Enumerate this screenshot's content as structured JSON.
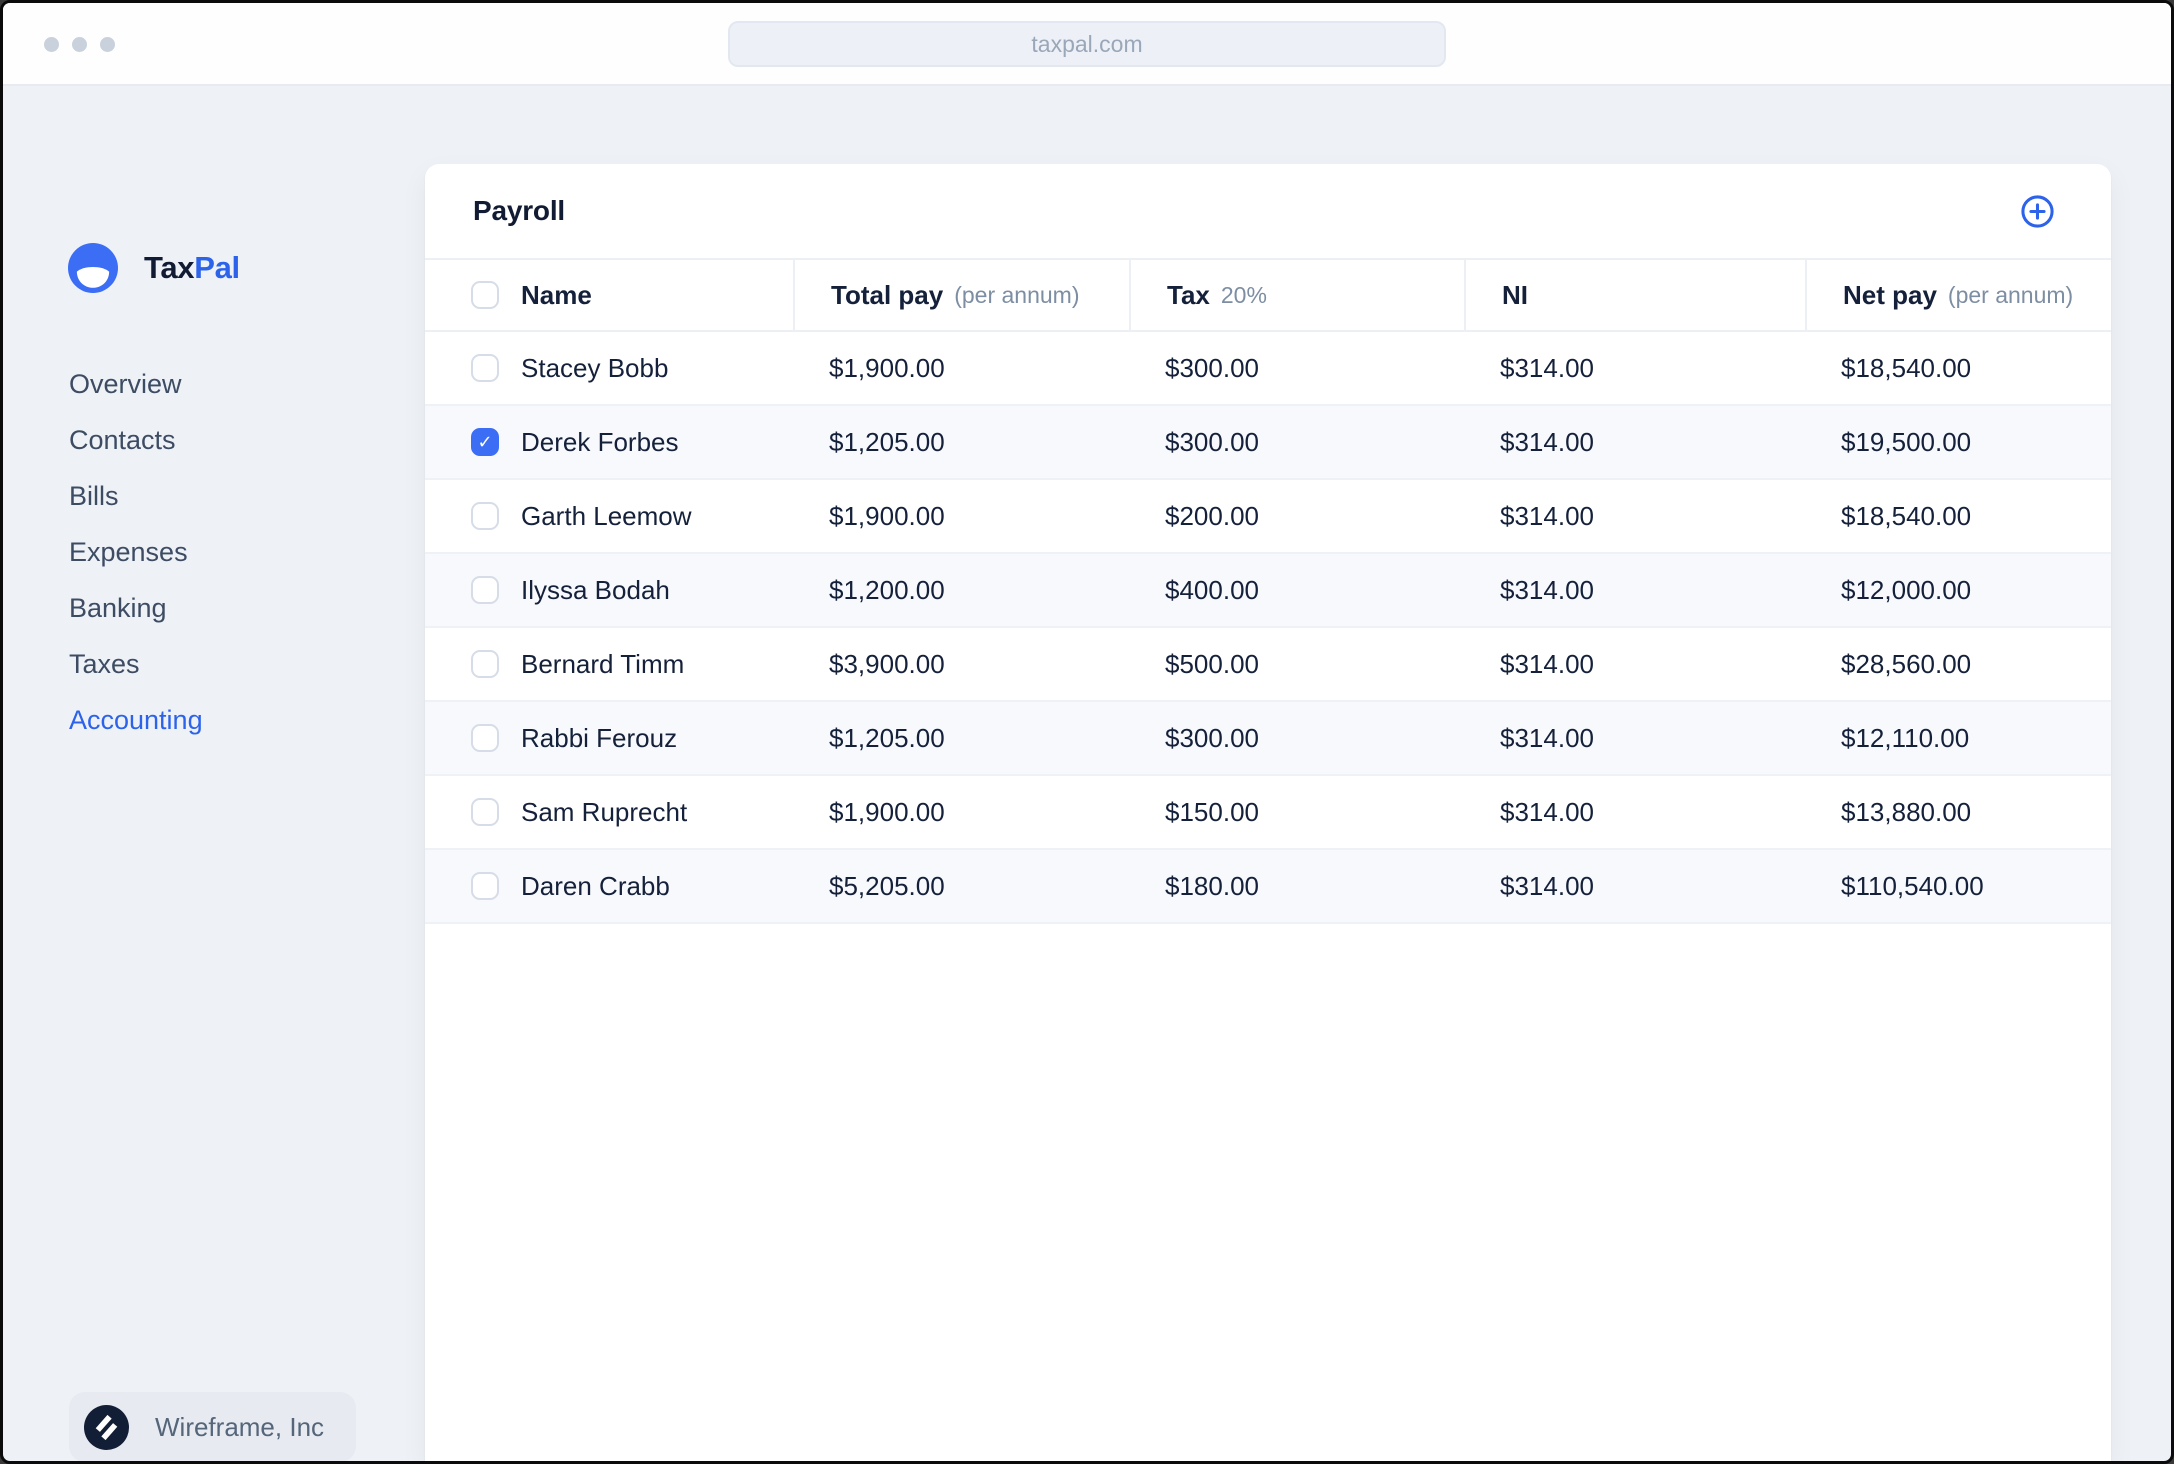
{
  "window": {
    "url": "taxpal.com"
  },
  "colors": {
    "accent": "#2d63ea",
    "checkbox_checked": "#3b6ef5",
    "text_dark": "#15213a",
    "text_muted": "#7d8ea3",
    "background": "#eef2f7"
  },
  "icons": {
    "window_controls": "window-dots-icon",
    "brand": "taxpal-logo-icon",
    "add": "plus-circle-icon",
    "company": "wireframe-logo-icon"
  },
  "sidebar": {
    "brand_primary": "Tax",
    "brand_secondary": "Pal",
    "items": [
      {
        "label": "Overview",
        "active": false
      },
      {
        "label": "Contacts",
        "active": false
      },
      {
        "label": "Bills",
        "active": false
      },
      {
        "label": "Expenses",
        "active": false
      },
      {
        "label": "Banking",
        "active": false
      },
      {
        "label": "Taxes",
        "active": false
      },
      {
        "label": "Accounting",
        "active": true
      }
    ],
    "company": "Wireframe, Inc"
  },
  "payroll": {
    "title": "Payroll",
    "columns": [
      {
        "label": "Name",
        "sublabel": ""
      },
      {
        "label": "Total pay",
        "sublabel": "(per annum)"
      },
      {
        "label": "Tax",
        "sublabel": "20%"
      },
      {
        "label": "NI",
        "sublabel": ""
      },
      {
        "label": "Net pay",
        "sublabel": "(per annum)"
      }
    ],
    "rows": [
      {
        "name": "Stacey Bobb",
        "total_pay": "$1,900.00",
        "tax": "$300.00",
        "ni": "$314.00",
        "net_pay": "$18,540.00",
        "checked": false
      },
      {
        "name": "Derek Forbes",
        "total_pay": "$1,205.00",
        "tax": "$300.00",
        "ni": "$314.00",
        "net_pay": "$19,500.00",
        "checked": true
      },
      {
        "name": "Garth Leemow",
        "total_pay": "$1,900.00",
        "tax": "$200.00",
        "ni": "$314.00",
        "net_pay": "$18,540.00",
        "checked": false
      },
      {
        "name": "Ilyssa Bodah",
        "total_pay": "$1,200.00",
        "tax": "$400.00",
        "ni": "$314.00",
        "net_pay": "$12,000.00",
        "checked": false
      },
      {
        "name": "Bernard Timm",
        "total_pay": "$3,900.00",
        "tax": "$500.00",
        "ni": "$314.00",
        "net_pay": "$28,560.00",
        "checked": false
      },
      {
        "name": "Rabbi Ferouz",
        "total_pay": "$1,205.00",
        "tax": "$300.00",
        "ni": "$314.00",
        "net_pay": "$12,110.00",
        "checked": false
      },
      {
        "name": "Sam Ruprecht",
        "total_pay": "$1,900.00",
        "tax": "$150.00",
        "ni": "$314.00",
        "net_pay": "$13,880.00",
        "checked": false
      },
      {
        "name": "Daren Crabb",
        "total_pay": "$5,205.00",
        "tax": "$180.00",
        "ni": "$314.00",
        "net_pay": "$110,540.00",
        "checked": false
      }
    ]
  }
}
